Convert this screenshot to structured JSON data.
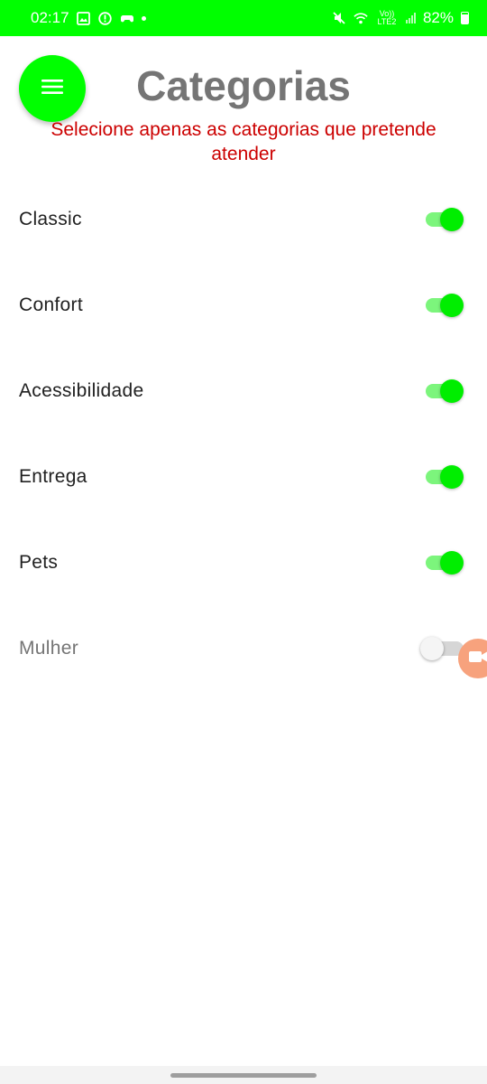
{
  "status_bar": {
    "time": "02:17",
    "carrier": "Vo)) LTE2",
    "battery": "82%",
    "background": "#00ff00",
    "icons_left": [
      "gallery-icon",
      "alert-icon",
      "game-icon",
      "dot"
    ],
    "icons_right": [
      "mute-icon",
      "wifi-icon",
      "volte-icon",
      "signal-icon",
      "battery-icon"
    ]
  },
  "header": {
    "title": "Categorias",
    "subtitle": "Selecione apenas as categorias que pretende atender",
    "menu_icon": "hamburger-menu-icon"
  },
  "categories": [
    {
      "label": "Classic",
      "enabled": true
    },
    {
      "label": "Confort",
      "enabled": true
    },
    {
      "label": "Acessibilidade",
      "enabled": true
    },
    {
      "label": "Entrega",
      "enabled": true
    },
    {
      "label": "Pets",
      "enabled": true
    },
    {
      "label": "Mulher",
      "enabled": false
    }
  ],
  "floating_bubble": {
    "icon": "video-camera-icon",
    "color": "#f7a27d"
  },
  "colors": {
    "accent": "#00ff00",
    "title": "#757575",
    "subtitle": "#cc0000"
  }
}
